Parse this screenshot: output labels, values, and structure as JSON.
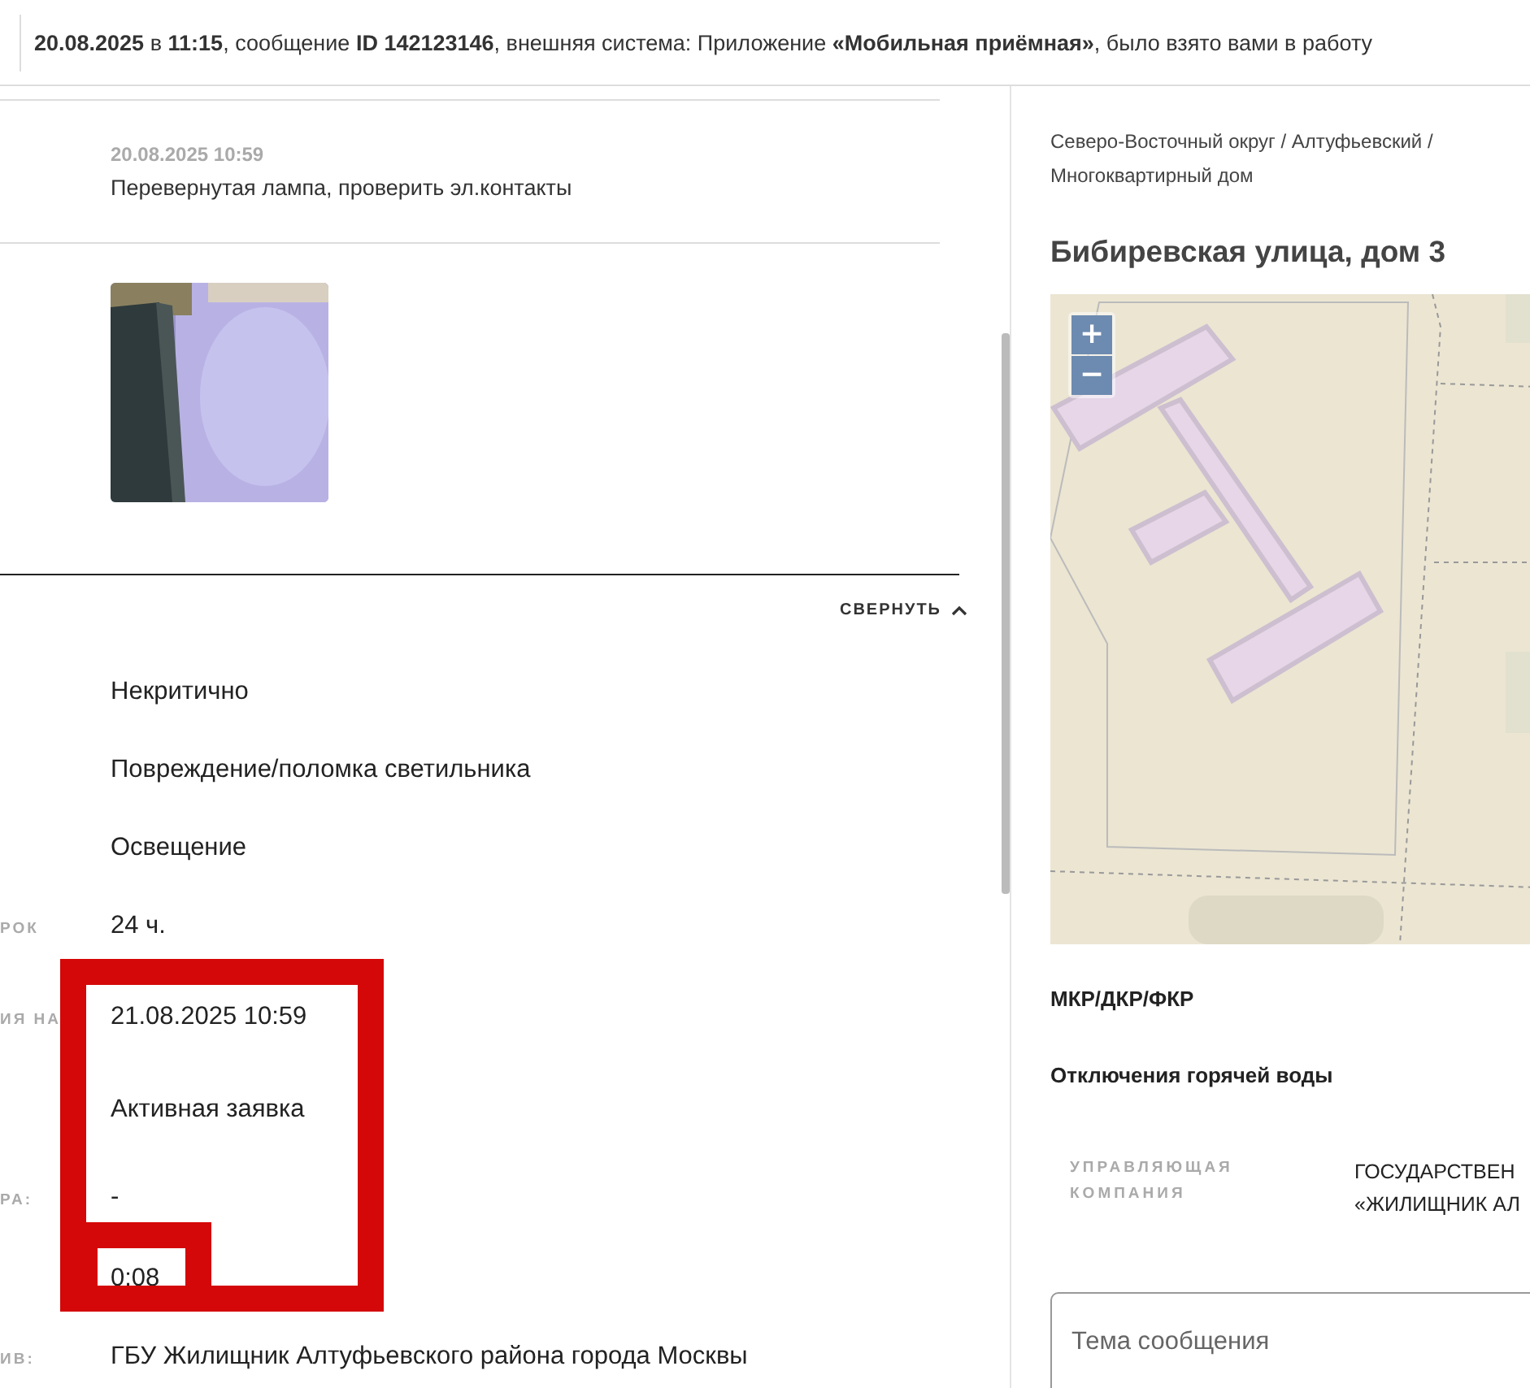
{
  "notice": "**20.08.2025** в **11:15**, сообщение **ID 142123146**, внешняя система: Приложение **«Мобильная приёмная»**, было взято вами в работу",
  "comment": {
    "date": "20.08.2025 10:59",
    "text": "Перевернутая лампа, проверить эл.контакты"
  },
  "details": {
    "toggle": "СВЕРНУТЬ",
    "expanded": true,
    "rows": [
      {
        "value": "Некритично"
      },
      {
        "value": "Повреждение/поломка светильника"
      },
      {
        "value": "Освещение"
      },
      {
        "label": "РОК",
        "value": "24 ч."
      },
      {
        "label": "ИЯ НА",
        "value": "21.08.2025 10:59"
      },
      {
        "value": "Активная заявка"
      },
      {
        "label": "РА:",
        "value": "-"
      },
      {
        "value": "0:08"
      },
      {
        "label": "ИВ:",
        "value": "ГБУ Жилищник Алтуфьевского района города Москвы"
      }
    ]
  },
  "address": {
    "breadcrumb": "Северо-Восточный округ / Алтуфьевский / Многоквартирный дом",
    "title": "Бибиревская улица, дом 3"
  },
  "map": {
    "kind": "picture",
    "zoom_in": "+",
    "zoom_out": "−"
  },
  "sections": [
    "МКР/ДКР/ФКР",
    "Отключения горячей воды"
  ],
  "management": {
    "label": "УПРАВЛЯЮЩАЯ КОМПАНИЯ",
    "value": [
      "ГОСУДАРСТВЕН",
      "«ЖИЛИЩНИК АЛ"
    ]
  },
  "message_field": {
    "placeholder": "Тема сообщения"
  }
}
